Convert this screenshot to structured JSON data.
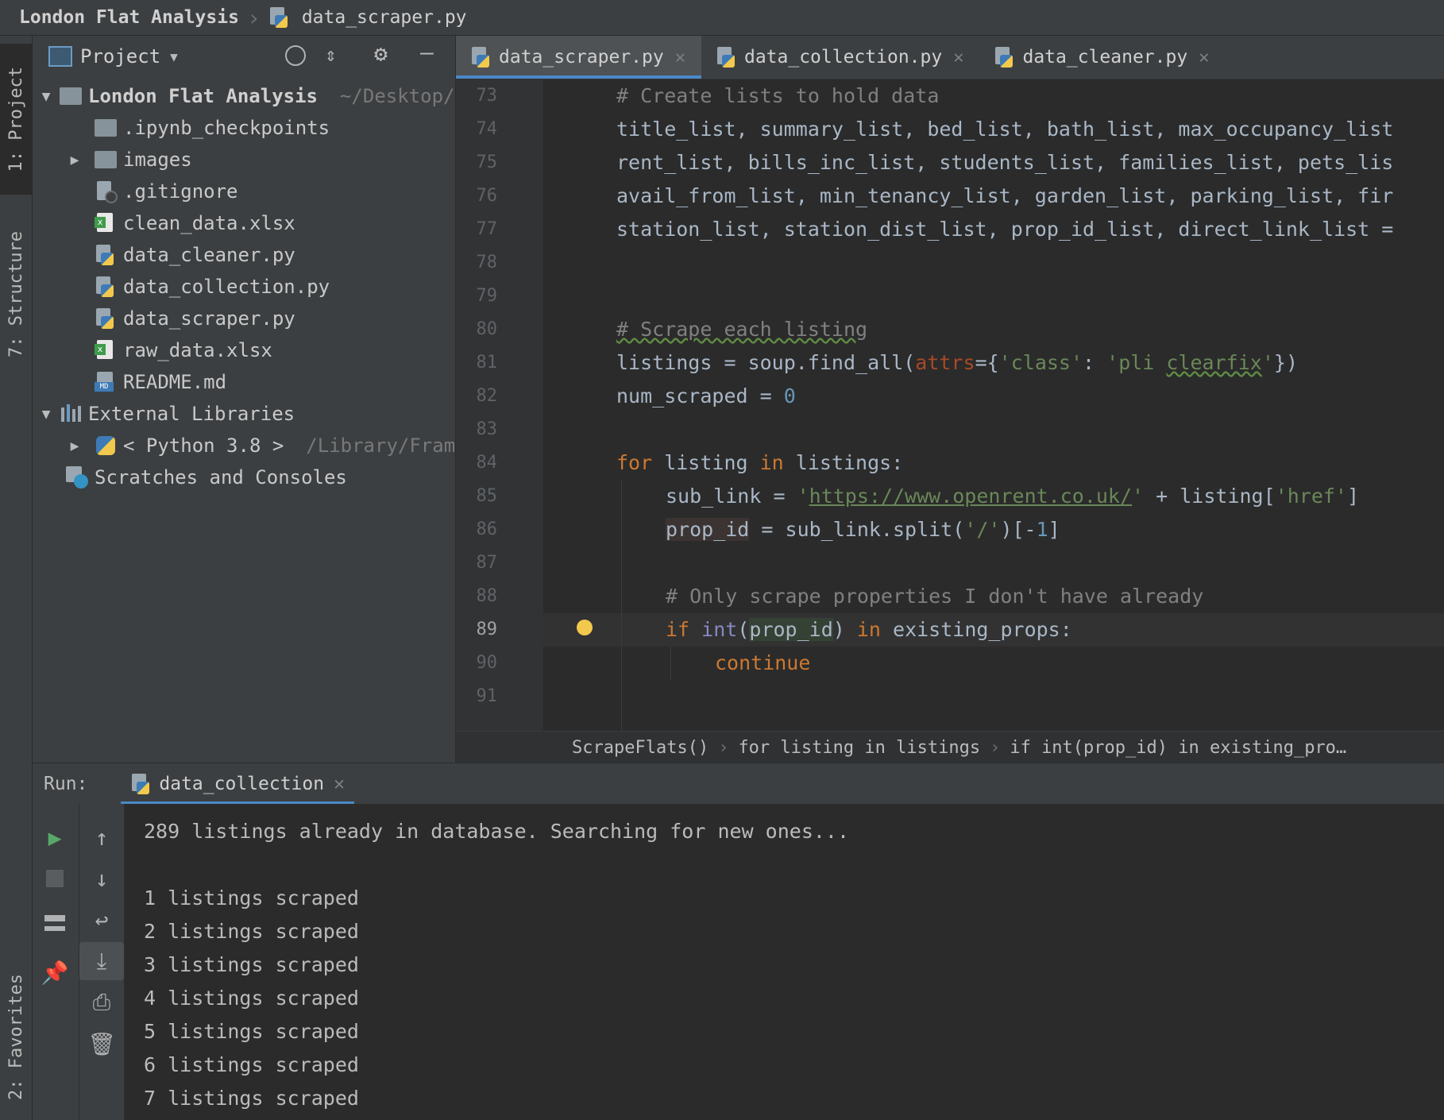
{
  "titlebar": {
    "project": "London Flat Analysis",
    "file": "data_scraper.py"
  },
  "left_strip": {
    "project_tab": "1: Project",
    "structure_tab": "7: Structure",
    "favorites_tab": "2: Favorites"
  },
  "project_panel": {
    "title": "Project",
    "tree": [
      {
        "label": "London Flat Analysis",
        "suffix": "~/Desktop/",
        "icon": "folder-icon",
        "expanded": true
      },
      {
        "label": ".ipynb_checkpoints",
        "icon": "folder-icon"
      },
      {
        "label": "images",
        "icon": "folder-icon",
        "collapsed": true
      },
      {
        "label": ".gitignore",
        "icon": "gitignore-file-icon"
      },
      {
        "label": "clean_data.xlsx",
        "icon": "excel-file-icon"
      },
      {
        "label": "data_cleaner.py",
        "icon": "python-file-icon"
      },
      {
        "label": "data_collection.py",
        "icon": "python-file-icon"
      },
      {
        "label": "data_scraper.py",
        "icon": "python-file-icon"
      },
      {
        "label": "raw_data.xlsx",
        "icon": "excel-file-icon"
      },
      {
        "label": "README.md",
        "icon": "markdown-file-icon"
      },
      {
        "label": "External Libraries",
        "icon": "library-icon",
        "expanded": true
      },
      {
        "label": "< Python 3.8 >",
        "suffix": "/Library/Fram",
        "icon": "python-sdk-icon",
        "collapsed": true
      },
      {
        "label": "Scratches and Consoles",
        "icon": "scratches-icon"
      }
    ]
  },
  "tabs": [
    {
      "label": "data_scraper.py",
      "active": true
    },
    {
      "label": "data_collection.py",
      "active": false
    },
    {
      "label": "data_cleaner.py",
      "active": false
    }
  ],
  "editor": {
    "line_numbers": [
      "73",
      "74",
      "75",
      "76",
      "77",
      "78",
      "79",
      "80",
      "81",
      "82",
      "83",
      "84",
      "85",
      "86",
      "87",
      "88",
      "89",
      "90",
      "91"
    ],
    "current_line": "89",
    "lines": {
      "l73": "# Create lists to hold data",
      "l74": "title_list, summary_list, bed_list, bath_list, max_occupancy_list",
      "l75": "rent_list, bills_inc_list, students_list, families_list, pets_lis",
      "l76": "avail_from_list, min_tenancy_list, garden_list, parking_list, fir",
      "l77": "station_list, station_dist_list, prop_id_list, direct_link_list =",
      "l80": "# Scrape each listing",
      "l81_a": "listings = soup.find_all(",
      "l81_param": "attrs",
      "l81_b": "={",
      "l81_s1": "'class'",
      "l81_c": ": ",
      "l81_s2a": "'pli ",
      "l81_s2b": "clearfix",
      "l81_s2c": "'",
      "l81_d": "})",
      "l82_a": "num_scraped = ",
      "l82_num": "0",
      "l84_kw1": "for",
      "l84_a": " listing ",
      "l84_kw2": "in",
      "l84_b": " listings:",
      "l85_a": "sub_link = ",
      "l85_q1": "'",
      "l85_url": "https://www.openrent.co.uk/",
      "l85_q2": "'",
      "l85_b": " + listing[",
      "l85_s": "'href'",
      "l85_c": "]",
      "l86_var": "prop_id",
      "l86_a": " = sub_link.split(",
      "l86_s": "'/'",
      "l86_b": ")[-",
      "l86_num": "1",
      "l86_c": "]",
      "l88": "# Only scrape properties I don't have already",
      "l89_kw1": "if",
      "l89_sp": " ",
      "l89_builtin": "int",
      "l89_a": "(",
      "l89_var": "prop_id",
      "l89_b": ") ",
      "l89_kw2": "in",
      "l89_c": " existing_props:",
      "l90_kw": "continue"
    }
  },
  "breadcrumb": [
    "ScrapeFlats()",
    "for listing in listings",
    "if int(prop_id) in existing_pro…"
  ],
  "run": {
    "label": "Run:",
    "tab": "data_collection",
    "console": [
      "289 listings already in database. Searching for new ones...",
      "",
      "1 listings scraped",
      "2 listings scraped",
      "3 listings scraped",
      "4 listings scraped",
      "5 listings scraped",
      "6 listings scraped",
      "7 listings scraped"
    ]
  },
  "colors": {
    "accent": "#4a88c7",
    "keyword": "#cc7832",
    "string": "#6a8759",
    "comment": "#808080",
    "number": "#6897bb",
    "run_green": "#59a869"
  }
}
